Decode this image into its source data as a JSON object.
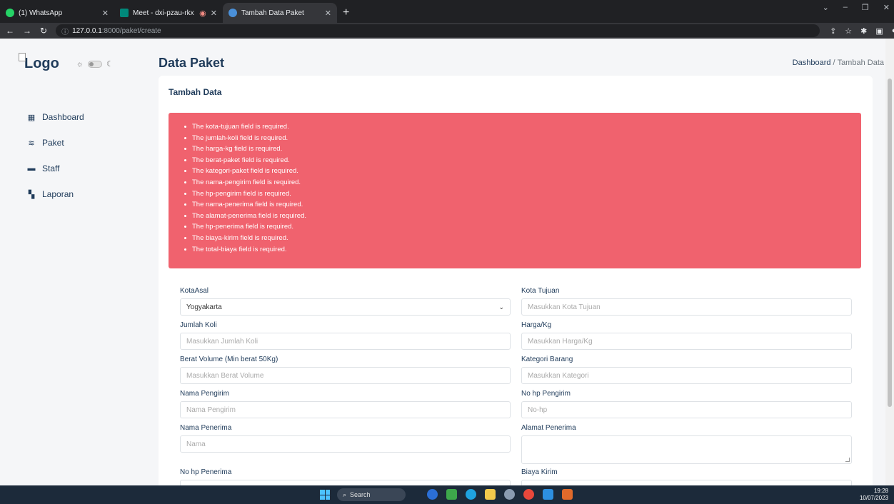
{
  "browser": {
    "tabs": [
      {
        "title": "(1) WhatsApp",
        "color": "#25d366"
      },
      {
        "title": "Meet - dxi-pzau-rkx",
        "color": "#00897b"
      },
      {
        "title": "Tambah Data Paket",
        "color": "#4a90d9"
      }
    ],
    "url_host": "127.0.0.1",
    "url_path": ":8000/paket/create"
  },
  "sidebar": {
    "logo_alt": "Logo",
    "items": [
      {
        "label": "Dashboard",
        "icon": "grid-icon"
      },
      {
        "label": "Paket",
        "icon": "stack-icon"
      },
      {
        "label": "Staff",
        "icon": "briefcase-icon"
      },
      {
        "label": "Laporan",
        "icon": "report-icon"
      }
    ]
  },
  "header": {
    "title": "Data Paket",
    "breadcrumb": {
      "home": "Dashboard",
      "sep": "/",
      "current": "Tambah Data"
    }
  },
  "card": {
    "title": "Tambah Data",
    "errors": [
      "The kota-tujuan field is required.",
      "The jumlah-koli field is required.",
      "The harga-kg field is required.",
      "The berat-paket field is required.",
      "The kategori-paket field is required.",
      "The nama-pengirim field is required.",
      "The hp-pengirim field is required.",
      "The nama-penerima field is required.",
      "The alamat-penerima field is required.",
      "The hp-penerima field is required.",
      "The biaya-kirim field is required.",
      "The total-biaya field is required."
    ]
  },
  "form": {
    "kota_asal": {
      "label": "KotaAsal",
      "value": "Yogyakarta"
    },
    "kota_tujuan": {
      "label": "Kota Tujuan",
      "placeholder": "Masukkan Kota Tujuan"
    },
    "jumlah_koli": {
      "label": "Jumlah Koli",
      "placeholder": "Masukkan Jumlah Koli"
    },
    "harga_kg": {
      "label": "Harga/Kg",
      "placeholder": "Masukkan Harga/Kg"
    },
    "berat": {
      "label": "Berat Volume (Min berat 50Kg)",
      "placeholder": "Masukkan Berat Volume"
    },
    "kategori": {
      "label": "Kategori Barang",
      "placeholder": "Masukkan Kategori"
    },
    "nama_pengirim": {
      "label": "Nama Pengirim",
      "placeholder": "Nama Pengirim"
    },
    "hp_pengirim": {
      "label": "No hp Pengirim",
      "placeholder": "No-hp"
    },
    "nama_penerima": {
      "label": "Nama Penerima",
      "placeholder": "Nama"
    },
    "alamat_penerima": {
      "label": "Alamat Penerima",
      "placeholder": ""
    },
    "hp_penerima": {
      "label": "No hp Penerima"
    },
    "biaya_kirim": {
      "label": "Biaya Kirim"
    }
  },
  "taskbar": {
    "search": "Search",
    "time": "19:28",
    "date": "10/07/2023"
  }
}
